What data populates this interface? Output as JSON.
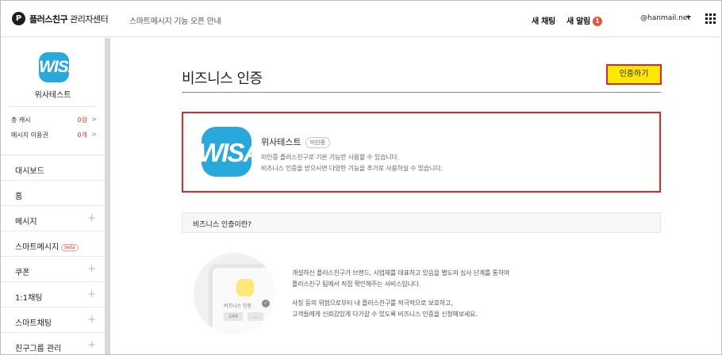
{
  "topbar": {
    "logo_glyph": "P",
    "logo_title": "플러스친구",
    "logo_subtitle": "관리자센터",
    "notice": "스마트메시지 기능 오픈 안내",
    "new_chat": "새 채팅",
    "new_alert": "새 알림",
    "alert_count": "1",
    "account": "@hanmail.net"
  },
  "sidebar": {
    "profile_logo_text": "WISA",
    "profile_name": "위사테스트",
    "stats": [
      {
        "label": "총 캐시",
        "value": "0원",
        "chevron": ">"
      },
      {
        "label": "메시지 이용권",
        "value": "0개",
        "chevron": ">"
      }
    ],
    "menu": [
      {
        "label": "대시보드",
        "plus": ""
      },
      {
        "label": "홈",
        "plus": ""
      },
      {
        "label": "메시지",
        "plus": "+"
      },
      {
        "label": "스마트메시지",
        "plus": "",
        "badge": "beta"
      },
      {
        "label": "쿠폰",
        "plus": "+"
      },
      {
        "label": "1:1채팅",
        "plus": "+"
      },
      {
        "label": "스마트채팅",
        "plus": "+"
      },
      {
        "label": "친구그룹 관리",
        "plus": "+"
      }
    ]
  },
  "main": {
    "page_title": "비즈니스 인증",
    "auth_button": "인증하기",
    "card": {
      "logo_text": "WISA",
      "name": "위사테스트",
      "status": "미인증",
      "desc1": "미인증 플러스친구로 기본 기능만 사용할 수 있습니다.",
      "desc2": "비즈니스 인증을 받으시면 다양한 기능을 추가로 사용하실 수 있습니다."
    },
    "section_title": "비즈니스 인증이란?",
    "illustration": {
      "label": "비즈니스 인증",
      "pill1": "249",
      "pill2": "...",
      "check": "✓"
    },
    "explanation": [
      "개설하신 플러스친구가 브랜드, 사업체를 대표하고 있음을 별도의 심사 단계를 통하여",
      "플러스친구 팀에서 직접 확인해주는 서비스입니다.",
      "사칭 등의 위험으로부터 내 플러스친구를 적극적으로 보호하고,",
      "고객들에게 신뢰감있게 다가갈 수 있도록 비즈니스 인증을 신청해보세요."
    ]
  }
}
